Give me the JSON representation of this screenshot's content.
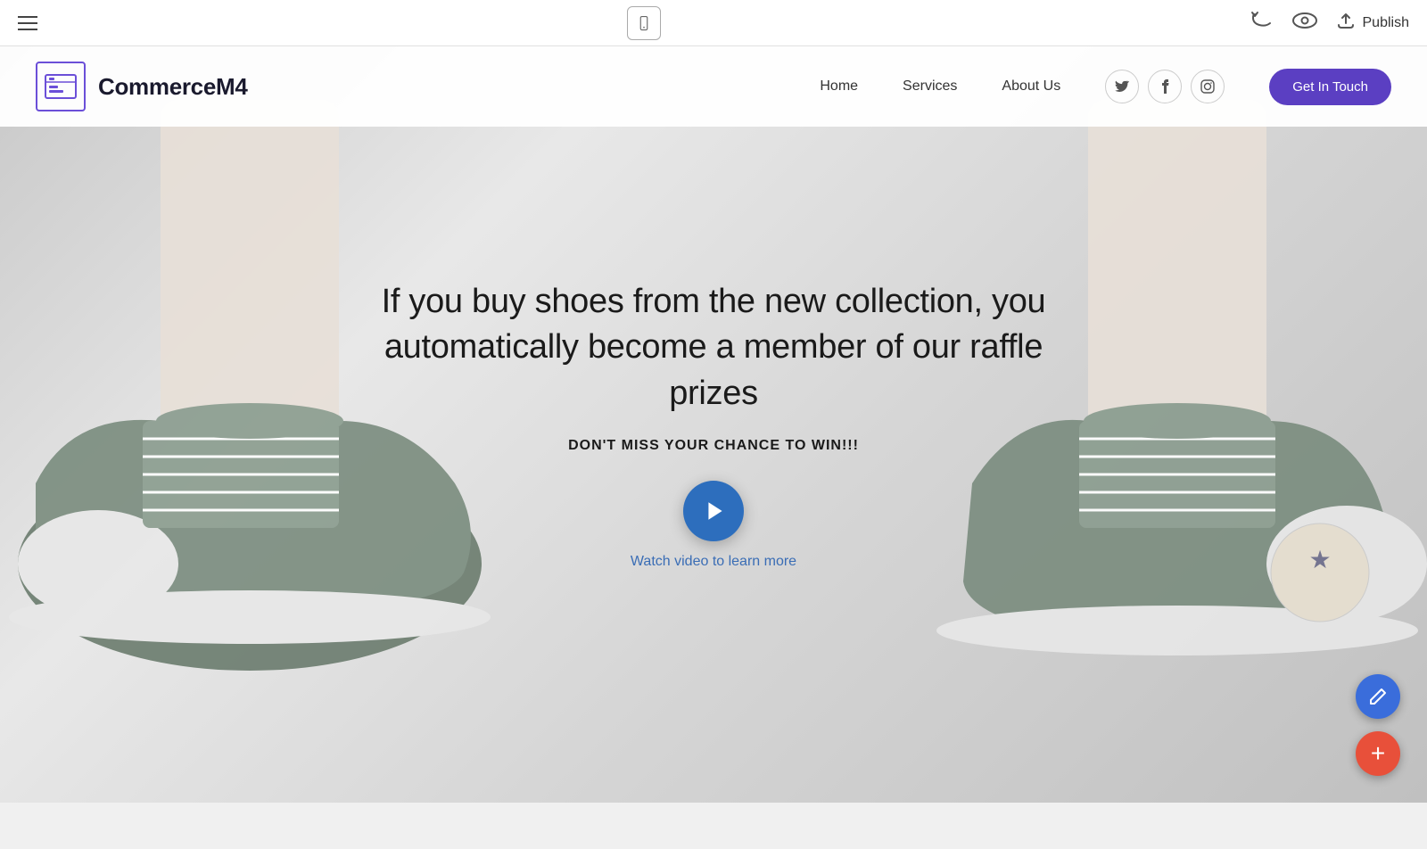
{
  "editor": {
    "publish_label": "Publish",
    "toolbar": {
      "hamburger_label": "Menu",
      "phone_preview_label": "Mobile preview",
      "undo_label": "Undo",
      "preview_label": "Preview"
    }
  },
  "site": {
    "title": "CommerceM4",
    "nav": {
      "home": "Home",
      "services": "Services",
      "about_us": "About Us"
    },
    "cta_button": "Get In Touch",
    "social": {
      "twitter_label": "Twitter",
      "facebook_label": "Facebook",
      "instagram_label": "Instagram"
    },
    "hero": {
      "main_text": "If you buy shoes from the new collection, you automatically become a member of our raffle prizes",
      "sub_text": "DON'T MISS YOUR CHANCE TO WIN!!!",
      "watch_video": "Watch video to learn more"
    }
  },
  "colors": {
    "logo_purple": "#6b4fd8",
    "nav_cta_purple": "#5b3fc2",
    "play_btn_blue": "#2d6ebd",
    "watch_video_blue": "#3a6db5",
    "fab_edit_blue": "#3a6ddb",
    "fab_add_red": "#e8503a"
  }
}
